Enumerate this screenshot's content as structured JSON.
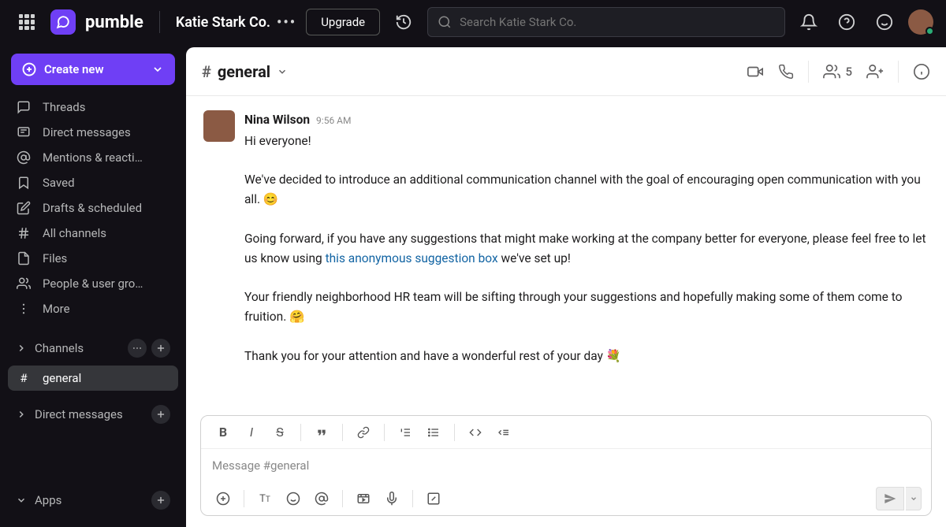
{
  "app": {
    "name": "pumble"
  },
  "workspace": {
    "name": "Katie Stark Co."
  },
  "topbar": {
    "upgrade": "Upgrade",
    "search_placeholder": "Search Katie Stark Co."
  },
  "sidebar": {
    "create": "Create new",
    "items": [
      {
        "label": "Threads"
      },
      {
        "label": "Direct messages"
      },
      {
        "label": "Mentions & reacti…"
      },
      {
        "label": "Saved"
      },
      {
        "label": "Drafts & scheduled"
      },
      {
        "label": "All channels"
      },
      {
        "label": "Files"
      },
      {
        "label": "People & user gro…"
      },
      {
        "label": "More"
      }
    ],
    "sections": {
      "channels": "Channels",
      "dms": "Direct messages",
      "apps": "Apps"
    },
    "active_channel": "general"
  },
  "channel": {
    "name": "general",
    "member_count": "5"
  },
  "message": {
    "author": "Nina Wilson",
    "time": "9:56 AM",
    "p1": "Hi everyone!",
    "p2a": "We've decided to introduce an additional communication channel with the goal of encouraging open communication with you all. ",
    "p2_emoji": "😊",
    "p3a": "Going forward, if you have any suggestions that might make working at the company better for everyone, please feel free to let us know using ",
    "p3_link": "this anonymous suggestion box",
    "p3b": " we've set up!",
    "p4a": "Your friendly neighborhood HR team will be sifting through your suggestions and hopefully making some of them come to fruition. ",
    "p4_emoji": "🤗",
    "p5a": "Thank you for your attention and have a wonderful rest of your day ",
    "p5_emoji": "💐"
  },
  "composer": {
    "placeholder": "Message #general"
  }
}
